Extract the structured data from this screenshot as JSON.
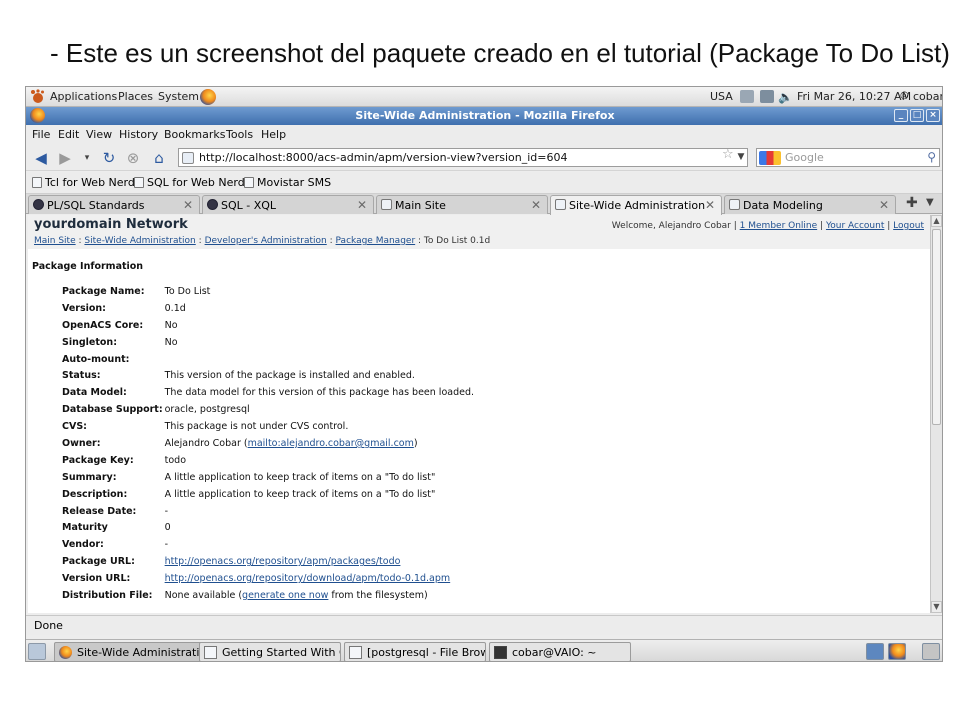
{
  "slide": {
    "title": "- Este es un screenshot del paquete creado en el tutorial (Package To Do List)"
  },
  "panel_top": {
    "applications": "Applications",
    "places": "Places",
    "system": "System",
    "keyboard": "USA",
    "clock": "Fri Mar 26, 10:27 AM",
    "user": "cobar"
  },
  "window": {
    "title": "Site-Wide Administration - Mozilla Firefox"
  },
  "menubar": [
    "File",
    "Edit",
    "View",
    "History",
    "Bookmarks",
    "Tools",
    "Help"
  ],
  "navbar": {
    "url": "http://localhost:8000/acs-admin/apm/version-view?version_id=604",
    "search_placeholder": "Google"
  },
  "bookmarks": [
    "Tcl for Web Nerds",
    "SQL for Web Nerds",
    "Movistar SMS"
  ],
  "tabs": [
    {
      "label": "PL/SQL Standards"
    },
    {
      "label": "SQL - XQL"
    },
    {
      "label": "Main Site"
    },
    {
      "label": "Site-Wide Administration"
    },
    {
      "label": "Data Modeling"
    }
  ],
  "site": {
    "name": "yourdomain Network",
    "welcome": "Welcome, Alejandro Cobar |",
    "members_online": "1 Member Online",
    "sep": "|",
    "your_account": "Your Account",
    "logout": "Logout",
    "breadcrumb": {
      "main_site": "Main Site",
      "site_admin": "Site-Wide Administration",
      "dev_admin": "Developer's Administration",
      "pkg_manager": "Package Manager",
      "sep": ":",
      "current": ": To Do List 0.1d"
    },
    "section_title": "Package Information"
  },
  "package": {
    "rows": [
      {
        "key": "Package Name:",
        "value": "To Do List"
      },
      {
        "key": "Version:",
        "value": "0.1d"
      },
      {
        "key": "OpenACS Core:",
        "value": "No"
      },
      {
        "key": "Singleton:",
        "value": "No"
      },
      {
        "key": "Auto-mount:",
        "value": ""
      },
      {
        "key": "Status:",
        "value": "This version of the package is installed and enabled."
      },
      {
        "key": "Data Model:",
        "value": "The data model for this version of this package has been loaded."
      },
      {
        "key": "Database Support:",
        "value": "oracle, postgresql"
      },
      {
        "key": "CVS:",
        "value": "This package is not under CVS control."
      },
      {
        "key": "Owner:",
        "value": "Alejandro Cobar ("
      },
      {
        "key": "Package Key:",
        "value": "todo"
      },
      {
        "key": "Summary:",
        "value": "A little application to keep track of items on a \"To do list\""
      },
      {
        "key": "Description:",
        "value": "A little application to keep track of items on a \"To do list\""
      },
      {
        "key": "Release Date:",
        "value": "-"
      },
      {
        "key": "Maturity",
        "value": "0"
      },
      {
        "key": "Vendor:",
        "value": "-"
      },
      {
        "key": "Package URL:",
        "value": ""
      },
      {
        "key": "Version URL:",
        "value": ""
      },
      {
        "key": "Distribution File:",
        "value": "None available ("
      }
    ],
    "owner_mail": "mailto:alejandro.cobar@gmail.com",
    "owner_close": ")",
    "package_url": "http://openacs.org/repository/apm/packages/todo",
    "version_url": "http://openacs.org/repository/download/apm/todo-0.1d.apm",
    "dist_link": "generate one now",
    "dist_tail": " from the filesystem)"
  },
  "status": "Done",
  "taskbar": [
    {
      "label": "Site-Wide Administrati..."
    },
    {
      "label": "Getting Started With O..."
    },
    {
      "label": "[postgresql - File Brow..."
    },
    {
      "label": "cobar@VAIO: ~"
    }
  ]
}
